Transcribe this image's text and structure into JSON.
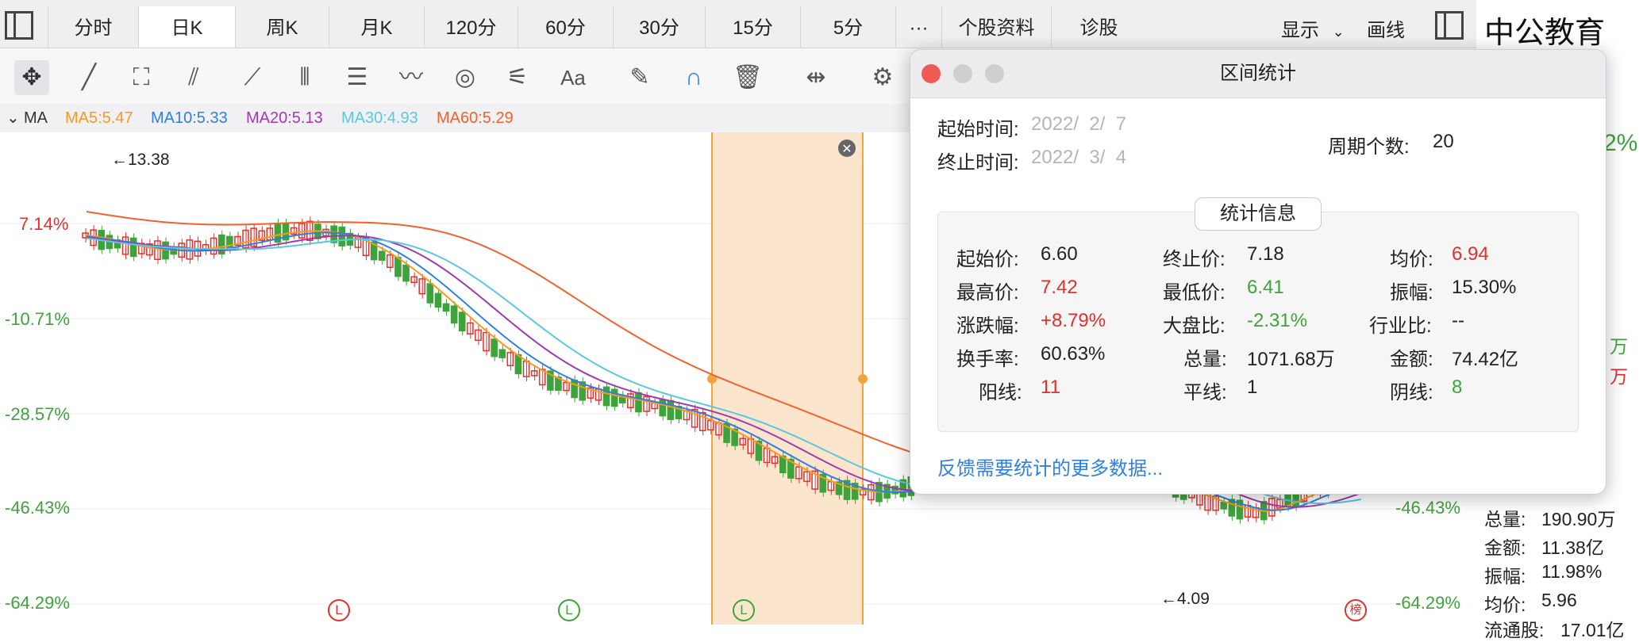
{
  "tabs": [
    "分时",
    "日K",
    "周K",
    "月K",
    "120分",
    "60分",
    "30分",
    "15分",
    "5分",
    "···",
    "个股资料",
    "诊股"
  ],
  "active_tab": "日K",
  "display_label": "显示",
  "draw_label": "画线",
  "stock_name": "中公教育",
  "tools": [
    "move-tool",
    "line-tool",
    "rect-tool",
    "fan-tool",
    "segment-tool",
    "parallel-tool",
    "text-channel-tool",
    "wave-tool",
    "cycle-tool",
    "gann-tool",
    "text-tool",
    "eraser-tool",
    "magnet-tool",
    "trash-tool",
    "range-tool",
    "settings-tool"
  ],
  "ma_bar": {
    "label": "MA",
    "ma5": "MA5:5.47",
    "ma10": "MA10:5.33",
    "ma20": "MA20:5.13",
    "ma30": "MA30:4.93",
    "ma60": "MA60:5.29"
  },
  "y_axis": [
    "7.14%",
    "-10.71%",
    "-28.57%",
    "-46.43%",
    "-64.29%"
  ],
  "right_axis": [
    "2%",
    "-46.43%",
    "-64.29%"
  ],
  "high_marker": "←13.38",
  "low_marker": "←4.09",
  "event_marks": [
    "L",
    "L",
    "L",
    "榜"
  ],
  "colors": {
    "up": "#e0312d",
    "down": "#3da33a",
    "ma5": "#f59a23",
    "ma10": "#2f80e0",
    "ma20": "#a03ab0",
    "ma30": "#5bc8e0",
    "ma60": "#f0622e",
    "selection": "#f5a33c"
  },
  "chart_data": {
    "type": "candlestick",
    "series": [
      {
        "name": "MA5",
        "last": 5.47
      },
      {
        "name": "MA10",
        "last": 5.33
      },
      {
        "name": "MA20",
        "last": 5.13
      },
      {
        "name": "MA30",
        "last": 4.93
      },
      {
        "name": "MA60",
        "last": 5.29
      }
    ],
    "high": 13.38,
    "low": 4.09,
    "ylim_percent": [
      -64.29,
      7.14
    ]
  },
  "dialog": {
    "title": "区间统计",
    "start_label": "起始时间:",
    "start_value": "2022/  2/  7",
    "end_label": "终止时间:",
    "end_value": "2022/  3/  4",
    "period_label": "周期个数:",
    "period_value": "20",
    "stat_header": "统计信息",
    "stats": {
      "open_label": "起始价:",
      "open": "6.60",
      "close_label": "终止价:",
      "close": "7.18",
      "avg_label": "均价:",
      "avg": "6.94",
      "high_label": "最高价:",
      "high": "7.42",
      "low_label": "最低价:",
      "low": "6.41",
      "amp_label": "振幅:",
      "amp": "15.30%",
      "chg_label": "涨跌幅:",
      "chg": "+8.79%",
      "market_label": "大盘比:",
      "market": "-2.31%",
      "industry_label": "行业比:",
      "industry": "--",
      "turnover_label": "换手率:",
      "turnover": "60.63%",
      "volume_label": "总量:",
      "volume": "1071.68万",
      "amount_label": "金额:",
      "amount": "74.42亿",
      "up_label": "阳线:",
      "up": "11",
      "flat_label": "平线:",
      "flat": "1",
      "down_label": "阴线:",
      "down": "8"
    },
    "feedback": "反馈需要统计的更多数据..."
  },
  "right_panel": {
    "partial_1": "万",
    "partial_2": "万",
    "volume_label": "总量:",
    "volume": "190.90万",
    "amount_label": "金额:",
    "amount": "11.38亿",
    "amp_label": "振幅:",
    "amp": "11.98%",
    "avg_label": "均价:",
    "avg": "5.96",
    "float_label": "流通股:",
    "float": "17.01亿"
  }
}
